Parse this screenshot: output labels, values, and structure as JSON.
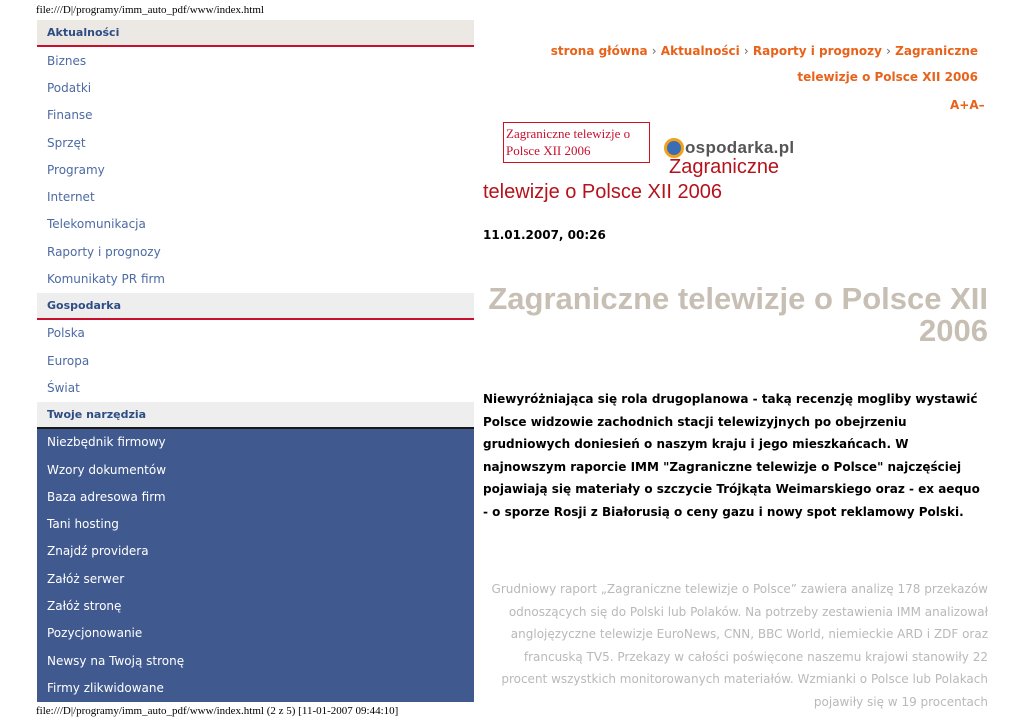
{
  "pdf": {
    "header_path": "file:///D|/programy/imm_auto_pdf/www/index.html",
    "footer_path": "file:///D|/programy/imm_auto_pdf/www/index.html (2 z 5) [11-01-2007 09:44:10]"
  },
  "sidebar": {
    "sections": [
      {
        "title": "Aktualności",
        "items": [
          "Biznes",
          "Podatki",
          "Finanse",
          "Sprzęt",
          "Programy",
          "Internet",
          "Telekomunikacja",
          "Raporty i prognozy",
          "Komunikaty PR firm"
        ]
      },
      {
        "title": "Gospodarka",
        "items": [
          "Polska",
          "Europa",
          "Świat"
        ]
      },
      {
        "title": "Twoje narzędzia",
        "items": [
          "Niezbędnik firmowy",
          "Wzory dokumentów",
          "Baza adresowa firm",
          "Tani hosting",
          "Znajdź providera",
          "Załóż serwer",
          "Załóż stronę",
          "Pozycjonowanie",
          "Newsy na Twoją stronę",
          "Firmy zlikwidowane"
        ]
      }
    ]
  },
  "breadcrumb": {
    "items": [
      "strona główna",
      "Aktualności",
      "Raporty i prognozy",
      "Zagraniczne telewizje o Polsce XII 2006"
    ],
    "separator": "›"
  },
  "font_size": {
    "increase": "A+",
    "decrease": "A–"
  },
  "article": {
    "image_alt_text": "Zagraniczne telewizje o Polsce XII 2006",
    "logo_text": "ospodarka.pl",
    "title_line1": "Zagraniczne",
    "title_line2": "telewizje o Polsce XII 2006",
    "date": "11.01.2007, 00:26",
    "heading": "Zagraniczne telewizje o Polsce XII 2006",
    "lead": "Niewyróżniająca się rola drugoplanowa - taką recenzję mogliby wystawić Polsce widzowie zachodnich stacji telewizyjnych po obejrzeniu grudniowych doniesień o naszym kraju i jego mieszkańcach. W najnowszym raporcie IMM \"Zagraniczne telewizje o Polsce\" najczęściej pojawiają się materiały o szczycie Trójkąta Weimarskiego oraz - ex aequo - o sporze Rosji z Białorusią o ceny gazu i nowy spot reklamowy Polski.",
    "body": "Grudniowy raport „Zagraniczne telewizje o Polsce” zawiera analizę 178 przekazów odnoszących się do Polski lub Polaków. Na potrzeby zestawienia IMM analizował anglojęzyczne telewizje EuroNews, CNN, BBC World, niemieckie ARD i ZDF oraz francuską TV5. Przekazy w całości poświęcone naszemu krajowi stanowiły 22 procent wszystkich monitorowanych materiałów. Wzmianki o Polsce lub Polakach pojawiły się w 19 procentach"
  },
  "colors": {
    "accent_orange": "#e8621a",
    "title_red": "#b5121b",
    "sidebar_blue": "#40598f",
    "link_blue": "#4c6aa3"
  }
}
